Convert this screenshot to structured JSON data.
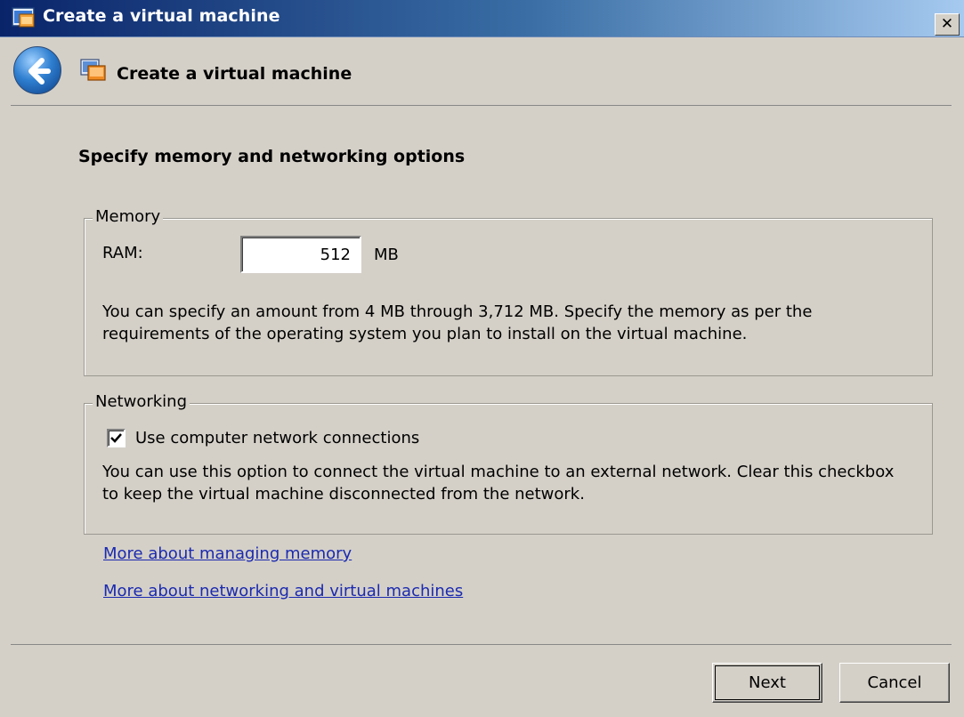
{
  "window": {
    "title": "Create a virtual machine",
    "close_glyph": "✕"
  },
  "header": {
    "title": "Create a virtual machine",
    "back_icon": "back-arrow-icon",
    "wizard_icon": "virtual-machine-icon"
  },
  "step": {
    "title": "Specify memory and networking options"
  },
  "memory_group": {
    "legend": "Memory",
    "ram_label": "RAM:",
    "ram_value": "512",
    "ram_unit": "MB",
    "help_text": "You can specify an amount from 4 MB through 3,712 MB. Specify the memory as per the requirements of the operating system you plan to install on the virtual machine."
  },
  "network_group": {
    "legend": "Networking",
    "checkbox_label": "Use computer network connections",
    "checkbox_checked": true,
    "help_text": "You can use this option to connect the virtual machine to an external network. Clear this checkbox to keep the virtual machine disconnected from the network."
  },
  "links": [
    "More about managing memory",
    "More about networking and virtual machines"
  ],
  "buttons": {
    "next": "Next",
    "cancel": "Cancel"
  },
  "colors": {
    "titlebar_start": "#0a246a",
    "titlebar_end": "#a6caf0",
    "dialog_bg": "#d4d0c8",
    "link": "#1b2ab0"
  }
}
